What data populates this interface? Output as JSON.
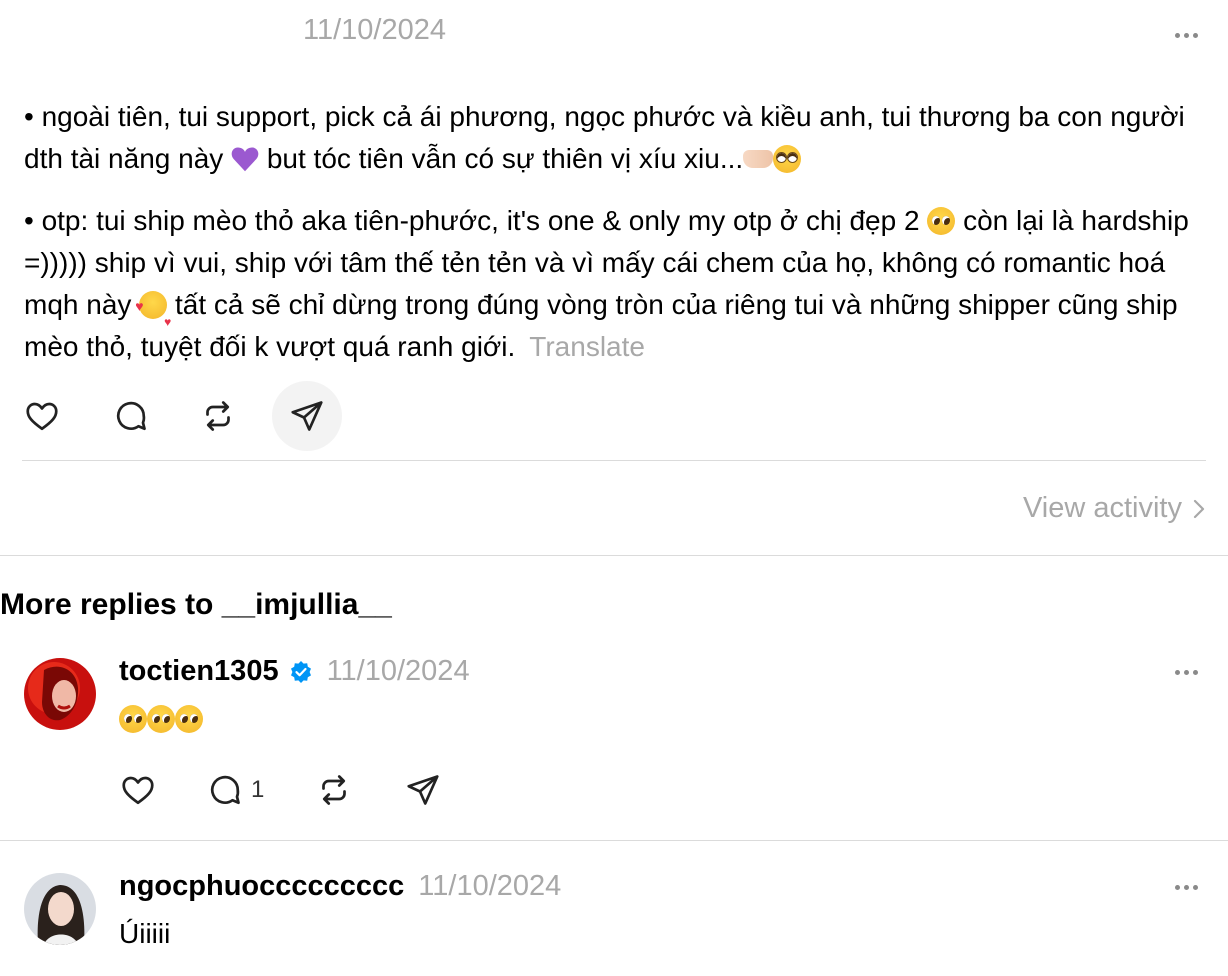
{
  "post": {
    "date": "11/10/2024",
    "para1_a": "• ngoài tiên, tui support, pick cả ái phương, ngọc phước và kiều anh, tui thương ba con người dth tài năng này",
    "para1_b": "but tóc tiên vẫn có sự thiên vị xíu xiu...",
    "para2_a": "• otp: tui ship mèo thỏ aka tiên-phước, it's one & only my otp ở chị đẹp 2",
    "para2_b": "còn lại là hardship =))))) ship vì vui, ship với tâm thế tẻn tẻn và vì mấy cái chem của họ, không có romantic hoá mqh này",
    "para2_c": "tất cả sẽ chỉ dừng trong đúng vòng tròn của riêng tui và những shipper cũng ship mèo thỏ, tuyệt đối k vượt quá ranh giới.",
    "translate_label": "Translate",
    "icons": [
      "heart-icon",
      "comment-icon",
      "repost-icon",
      "share-icon",
      "more-icon"
    ]
  },
  "view_activity_label": "View activity",
  "more_replies_title": "More replies to __imjullia__",
  "replies": [
    {
      "username": "toctien1305",
      "verified": true,
      "date": "11/10/2024",
      "comment_count": "1"
    },
    {
      "username": "ngocphuoccccccccc",
      "verified": false,
      "date": "11/10/2024",
      "text": "Úiiiii"
    }
  ],
  "colors": {
    "muted": "#a8a8a8",
    "divider": "#dbdbdb",
    "verified": "#0095f6",
    "purple_heart": "#9b59d0"
  }
}
